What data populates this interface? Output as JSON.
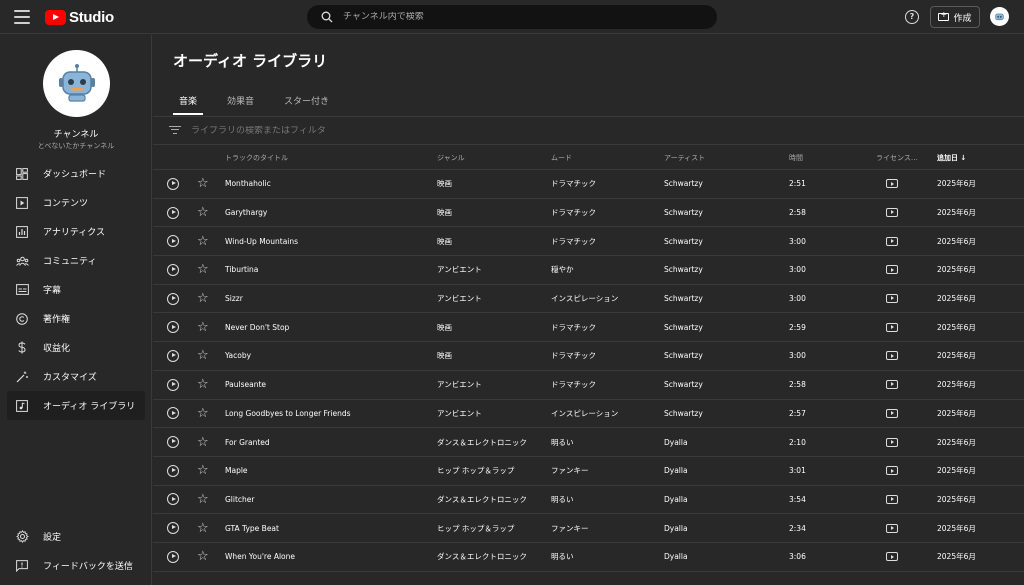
{
  "app": {
    "logo_text": "Studio"
  },
  "header": {
    "search_placeholder": "チャンネル内で検索",
    "help_label": "?",
    "create_label": "作成"
  },
  "sidebar": {
    "channel_name": "チャンネル",
    "channel_sub": "とべないたかチャンネル",
    "items": [
      {
        "label": "ダッシュボード",
        "icon": "dashboard-icon"
      },
      {
        "label": "コンテンツ",
        "icon": "content-icon"
      },
      {
        "label": "アナリティクス",
        "icon": "analytics-icon"
      },
      {
        "label": "コミュニティ",
        "icon": "community-icon"
      },
      {
        "label": "字幕",
        "icon": "subtitles-icon"
      },
      {
        "label": "著作権",
        "icon": "copyright-icon"
      },
      {
        "label": "収益化",
        "icon": "dollar-icon"
      },
      {
        "label": "カスタマイズ",
        "icon": "magic-wand-icon"
      },
      {
        "label": "オーディオ ライブラリ",
        "icon": "audio-library-icon",
        "active": true
      }
    ],
    "bottom": [
      {
        "label": "設定",
        "icon": "gear-icon"
      },
      {
        "label": "フィードバックを送信",
        "icon": "feedback-icon"
      }
    ]
  },
  "main": {
    "title": "オーディオ ライブラリ",
    "tabs": [
      {
        "label": "音楽",
        "active": true
      },
      {
        "label": "効果音"
      },
      {
        "label": "スター付き"
      }
    ],
    "filter_placeholder": "ライブラリの検索またはフィルタ",
    "columns": {
      "title": "トラックのタイトル",
      "genre": "ジャンル",
      "mood": "ムード",
      "artist": "アーティスト",
      "time": "時間",
      "license": "ライセンス…",
      "date": "追加日 ↓"
    },
    "rows": [
      {
        "title": "Monthaholic",
        "genre": "映画",
        "mood": "ドラマチック",
        "artist": "Schwartzy",
        "time": "2:51",
        "date": "2025年6月"
      },
      {
        "title": "Garythargy",
        "genre": "映画",
        "mood": "ドラマチック",
        "artist": "Schwartzy",
        "time": "2:58",
        "date": "2025年6月"
      },
      {
        "title": "Wind-Up Mountains",
        "genre": "映画",
        "mood": "ドラマチック",
        "artist": "Schwartzy",
        "time": "3:00",
        "date": "2025年6月"
      },
      {
        "title": "Tiburtina",
        "genre": "アンビエント",
        "mood": "穏やか",
        "artist": "Schwartzy",
        "time": "3:00",
        "date": "2025年6月"
      },
      {
        "title": "Sizzr",
        "genre": "アンビエント",
        "mood": "インスピレーション",
        "artist": "Schwartzy",
        "time": "3:00",
        "date": "2025年6月"
      },
      {
        "title": "Never Don't Stop",
        "genre": "映画",
        "mood": "ドラマチック",
        "artist": "Schwartzy",
        "time": "2:59",
        "date": "2025年6月"
      },
      {
        "title": "Yacoby",
        "genre": "映画",
        "mood": "ドラマチック",
        "artist": "Schwartzy",
        "time": "3:00",
        "date": "2025年6月"
      },
      {
        "title": "Paulseante",
        "genre": "アンビエント",
        "mood": "ドラマチック",
        "artist": "Schwartzy",
        "time": "2:58",
        "date": "2025年6月"
      },
      {
        "title": "Long Goodbyes to Longer Friends",
        "genre": "アンビエント",
        "mood": "インスピレーション",
        "artist": "Schwartzy",
        "time": "2:57",
        "date": "2025年6月"
      },
      {
        "title": "For Granted",
        "genre": "ダンス＆エレクトロニック",
        "mood": "明るい",
        "artist": "Dyalla",
        "time": "2:10",
        "date": "2025年6月"
      },
      {
        "title": "Maple",
        "genre": "ヒップ ホップ＆ラップ",
        "mood": "ファンキー",
        "artist": "Dyalla",
        "time": "3:01",
        "date": "2025年6月"
      },
      {
        "title": "Glitcher",
        "genre": "ダンス＆エレクトロニック",
        "mood": "明るい",
        "artist": "Dyalla",
        "time": "3:54",
        "date": "2025年6月"
      },
      {
        "title": "GTA Type Beat",
        "genre": "ヒップ ホップ＆ラップ",
        "mood": "ファンキー",
        "artist": "Dyalla",
        "time": "2:34",
        "date": "2025年6月"
      },
      {
        "title": "When You're Alone",
        "genre": "ダンス＆エレクトロニック",
        "mood": "明るい",
        "artist": "Dyalla",
        "time": "3:06",
        "date": "2025年6月"
      }
    ]
  }
}
